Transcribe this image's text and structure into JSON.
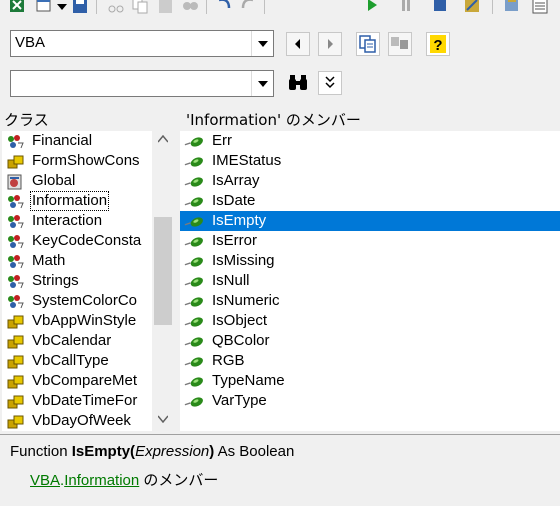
{
  "toolbar": {
    "icons": [
      "excel-icon",
      "userform-icon",
      "dropdown-icon",
      "save-icon",
      "cut-icon",
      "copy-icon",
      "paste-icon",
      "find-icon",
      "undo-icon",
      "redo-icon",
      "run-icon",
      "pause-icon",
      "reset-icon",
      "design-mode-icon",
      "project-explorer-icon",
      "properties-icon"
    ]
  },
  "library_combo": {
    "value": "VBA"
  },
  "search_combo": {
    "value": ""
  },
  "classes_panel": {
    "header": "クラス",
    "items": [
      {
        "label": "Financial",
        "icon": "module-icon"
      },
      {
        "label": "FormShowCons",
        "icon": "enum-icon"
      },
      {
        "label": "Global",
        "icon": "globals-icon"
      },
      {
        "label": "Information",
        "icon": "module-icon",
        "selected": true
      },
      {
        "label": "Interaction",
        "icon": "module-icon"
      },
      {
        "label": "KeyCodeConsta",
        "icon": "module-icon"
      },
      {
        "label": "Math",
        "icon": "module-icon"
      },
      {
        "label": "Strings",
        "icon": "module-icon"
      },
      {
        "label": "SystemColorCo",
        "icon": "module-icon"
      },
      {
        "label": "VbAppWinStyle",
        "icon": "enum-icon"
      },
      {
        "label": "VbCalendar",
        "icon": "enum-icon"
      },
      {
        "label": "VbCallType",
        "icon": "enum-icon"
      },
      {
        "label": "VbCompareMet",
        "icon": "enum-icon"
      },
      {
        "label": "VbDateTimeFor",
        "icon": "enum-icon"
      },
      {
        "label": "VbDayOfWeek",
        "icon": "enum-icon"
      }
    ]
  },
  "members_panel": {
    "header": "'Information' のメンバー",
    "items": [
      {
        "label": "Err"
      },
      {
        "label": "IMEStatus"
      },
      {
        "label": "IsArray"
      },
      {
        "label": "IsDate"
      },
      {
        "label": "IsEmpty",
        "selected": true
      },
      {
        "label": "IsError"
      },
      {
        "label": "IsMissing"
      },
      {
        "label": "IsNull"
      },
      {
        "label": "IsNumeric"
      },
      {
        "label": "IsObject"
      },
      {
        "label": "QBColor"
      },
      {
        "label": "RGB"
      },
      {
        "label": "TypeName"
      },
      {
        "label": "VarType"
      }
    ]
  },
  "details": {
    "prefix": "Function ",
    "name": "IsEmpty(",
    "param": "Expression",
    "close": ")",
    "suffix": " As Boolean",
    "lib_link": "VBA",
    "dot": ".",
    "class_link": "Information",
    "member_of": " のメンバー"
  },
  "colors": {
    "selection": "#0078d7",
    "link": "#007a00",
    "method_icon": "#2a8a1a"
  }
}
